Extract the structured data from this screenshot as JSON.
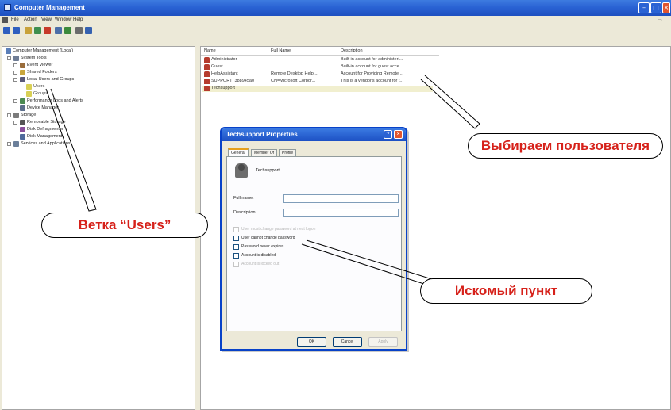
{
  "window": {
    "title": "Computer Management",
    "minimize_glyph": "–",
    "maximize_glyph": "□",
    "close_glyph": "×"
  },
  "menu": {
    "items": [
      "File",
      "Action",
      "View",
      "Window",
      "Help"
    ]
  },
  "toolbar": {
    "icons": [
      "back-icon",
      "forward-icon",
      "up-icon",
      "show-hide-tree-icon",
      "delete-icon",
      "properties-icon",
      "refresh-icon",
      "export-icon",
      "help-icon"
    ]
  },
  "tree": {
    "nodes": [
      {
        "label": "Computer Management (Local)",
        "icon": "computer-icon"
      },
      {
        "label": "System Tools",
        "icon": "tools-icon"
      },
      {
        "label": "Event Viewer",
        "icon": "event-viewer-icon"
      },
      {
        "label": "Shared Folders",
        "icon": "shared-folders-icon"
      },
      {
        "label": "Local Users and Groups",
        "icon": "users-groups-icon"
      },
      {
        "label": "Users",
        "icon": "folder-icon"
      },
      {
        "label": "Groups",
        "icon": "folder-icon"
      },
      {
        "label": "Performance Logs and Alerts",
        "icon": "performance-icon"
      },
      {
        "label": "Device Manager",
        "icon": "device-manager-icon"
      },
      {
        "label": "Storage",
        "icon": "storage-icon"
      },
      {
        "label": "Removable Storage",
        "icon": "removable-storage-icon"
      },
      {
        "label": "Disk Defragmenter",
        "icon": "defragmenter-icon"
      },
      {
        "label": "Disk Management",
        "icon": "disk-management-icon"
      },
      {
        "label": "Services and Applications",
        "icon": "services-icon"
      }
    ]
  },
  "list": {
    "columns": [
      "Name",
      "Full Name",
      "Description"
    ],
    "rows": [
      {
        "name": "Administrator",
        "full_name": "",
        "description": "Built-in account for administeri..."
      },
      {
        "name": "Guest",
        "full_name": "",
        "description": "Built-in account for guest acce..."
      },
      {
        "name": "HelpAssistant",
        "full_name": "Remote Desktop Help ...",
        "description": "Account for Providing Remote ..."
      },
      {
        "name": "SUPPORT_388945a0",
        "full_name": "CN=Microsoft Corpor...",
        "description": "This is a vendor's account for t..."
      },
      {
        "name": "Techsupport",
        "full_name": "",
        "description": ""
      }
    ]
  },
  "dialog": {
    "title": "Techsupport Properties",
    "help_glyph": "?",
    "close_glyph": "×",
    "tabs": [
      "General",
      "Member Of",
      "Profile"
    ],
    "user_name": "Techsupport",
    "fields": [
      {
        "label": "Full name:",
        "value": ""
      },
      {
        "label": "Description:",
        "value": ""
      }
    ],
    "checkboxes": [
      {
        "label": "User must change password at next logon",
        "checked": false,
        "disabled": true
      },
      {
        "label": "User cannot change password",
        "checked": false,
        "disabled": false
      },
      {
        "label": "Password never expires",
        "checked": false,
        "disabled": false
      },
      {
        "label": "Account is disabled",
        "checked": false,
        "disabled": false
      },
      {
        "label": "Account is locked out",
        "checked": false,
        "disabled": true
      }
    ],
    "buttons": {
      "ok": "OK",
      "cancel": "Cancel",
      "apply": "Apply"
    }
  },
  "annotations": {
    "select_user": "Выбираем пользователя",
    "users_branch": "Ветка “Users”",
    "target_item": "Искомый пункт"
  },
  "colors": {
    "annotation_text": "#d6211a",
    "titlebar": "#2a63d4",
    "selection": "#316ac5"
  }
}
